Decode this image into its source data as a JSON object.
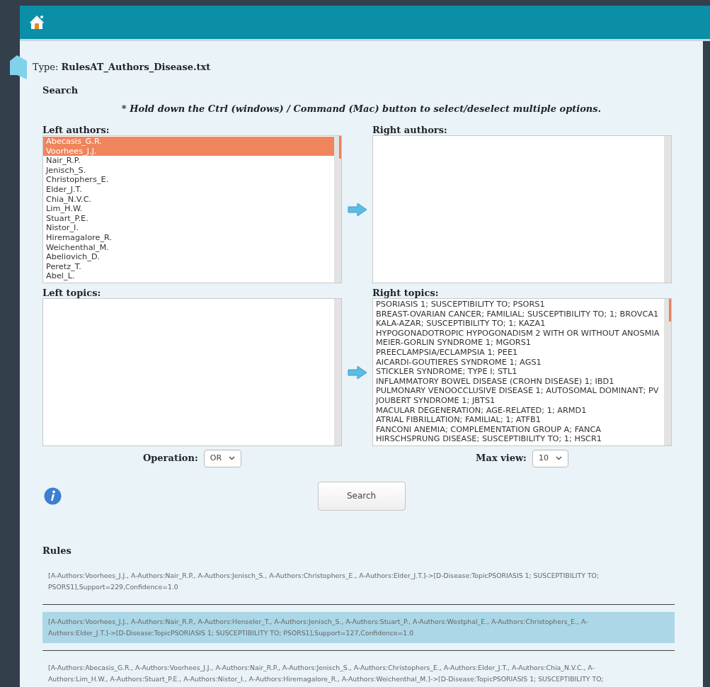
{
  "file_type": {
    "label": "Type:",
    "value": "RulesAT_Authors_Disease.txt"
  },
  "search": {
    "title": "Search",
    "hint": "* Hold down the Ctrl (windows) / Command (Mac) button to select/deselect multiple options."
  },
  "left_authors": {
    "label": "Left authors:",
    "items": [
      {
        "text": "Abecasis_G.R.",
        "selected": true
      },
      {
        "text": "Voorhees_J.J.",
        "selected": true
      },
      {
        "text": "Nair_R.P.",
        "selected": false
      },
      {
        "text": "Jenisch_S.",
        "selected": false
      },
      {
        "text": "Christophers_E.",
        "selected": false
      },
      {
        "text": "Elder_J.T.",
        "selected": false
      },
      {
        "text": "Chia_N.V.C.",
        "selected": false
      },
      {
        "text": "Lim_H.W.",
        "selected": false
      },
      {
        "text": "Stuart_P.E.",
        "selected": false
      },
      {
        "text": "Nistor_I.",
        "selected": false
      },
      {
        "text": "Hiremagalore_R.",
        "selected": false
      },
      {
        "text": "Weichenthal_M.",
        "selected": false
      },
      {
        "text": "Abeliovich_D.",
        "selected": false
      },
      {
        "text": "Peretz_T.",
        "selected": false
      },
      {
        "text": "Abel_L.",
        "selected": false
      }
    ]
  },
  "right_authors": {
    "label": "Right authors:"
  },
  "left_topics": {
    "label": "Left topics:"
  },
  "right_topics": {
    "label": "Right topics:",
    "items": [
      {
        "text": "PSORIASIS 1; SUSCEPTIBILITY TO; PSORS1",
        "selected": false
      },
      {
        "text": "BREAST-OVARIAN CANCER; FAMILIAL; SUSCEPTIBILITY TO; 1; BROVCA1",
        "selected": false
      },
      {
        "text": "KALA-AZAR; SUSCEPTIBILITY TO; 1; KAZA1",
        "selected": false
      },
      {
        "text": "HYPOGONADOTROPIC HYPOGONADISM 2 WITH OR WITHOUT ANOSMIA",
        "selected": false
      },
      {
        "text": "MEIER-GORLIN SYNDROME 1; MGORS1",
        "selected": false
      },
      {
        "text": "PREECLAMPSIA/ECLAMPSIA 1; PEE1",
        "selected": false
      },
      {
        "text": "AICARDI-GOUTIERES SYNDROME 1; AGS1",
        "selected": false
      },
      {
        "text": "STICKLER SYNDROME; TYPE I; STL1",
        "selected": false
      },
      {
        "text": "INFLAMMATORY BOWEL DISEASE (CROHN DISEASE) 1; IBD1",
        "selected": false
      },
      {
        "text": "PULMONARY VENOOCCLUSIVE DISEASE 1; AUTOSOMAL DOMINANT; PV",
        "selected": false
      },
      {
        "text": "JOUBERT SYNDROME 1; JBTS1",
        "selected": false
      },
      {
        "text": "MACULAR DEGENERATION; AGE-RELATED; 1; ARMD1",
        "selected": false
      },
      {
        "text": "ATRIAL FIBRILLATION; FAMILIAL; 1; ATFB1",
        "selected": false
      },
      {
        "text": "FANCONI ANEMIA; COMPLEMENTATION GROUP A; FANCA",
        "selected": false
      },
      {
        "text": "HIRSCHSPRUNG DISEASE; SUSCEPTIBILITY TO; 1; HSCR1",
        "selected": false
      }
    ]
  },
  "operation": {
    "label": "Operation:",
    "value": "OR"
  },
  "max_view": {
    "label": "Max view:",
    "value": "10"
  },
  "search_button": "Search",
  "rules": {
    "title": "Rules",
    "items": [
      {
        "text": "[A-Authors:Voorhees_J.J., A-Authors:Nair_R.P., A-Authors:Jenisch_S., A-Authors:Christophers_E., A-Authors:Elder_J.T.]->[D-Disease:TopicPSORIASIS 1; SUSCEPTIBILITY TO; PSORS1],Support=229,Confidence=1.0",
        "selected": false
      },
      {
        "text": "[A-Authors:Voorhees_J.J., A-Authors:Nair_R.P., A-Authors:Henseler_T., A-Authors:Jenisch_S., A-Authors:Stuart_P., A-Authors:Westphal_E., A-Authors:Christophers_E., A-Authors:Elder_J.T.]->[D-Disease:TopicPSORIASIS 1; SUSCEPTIBILITY TO; PSORS1],Support=127,Confidence=1.0",
        "selected": true
      },
      {
        "text": "[A-Authors:Abecasis_G.R., A-Authors:Voorhees_J.J., A-Authors:Nair_R.P., A-Authors:Jenisch_S., A-Authors:Christophers_E., A-Authors:Elder_J.T., A-Authors:Chia_N.V.C., A-Authors:Lim_H.W., A-Authors:Stuart_P.E., A-Authors:Nistor_I., A-Authors:Hiremagalore_R., A-Authors:Weichenthal_M.]->[D-Disease:TopicPSORIASIS 1; SUSCEPTIBILITY TO;",
        "selected": false
      }
    ]
  }
}
